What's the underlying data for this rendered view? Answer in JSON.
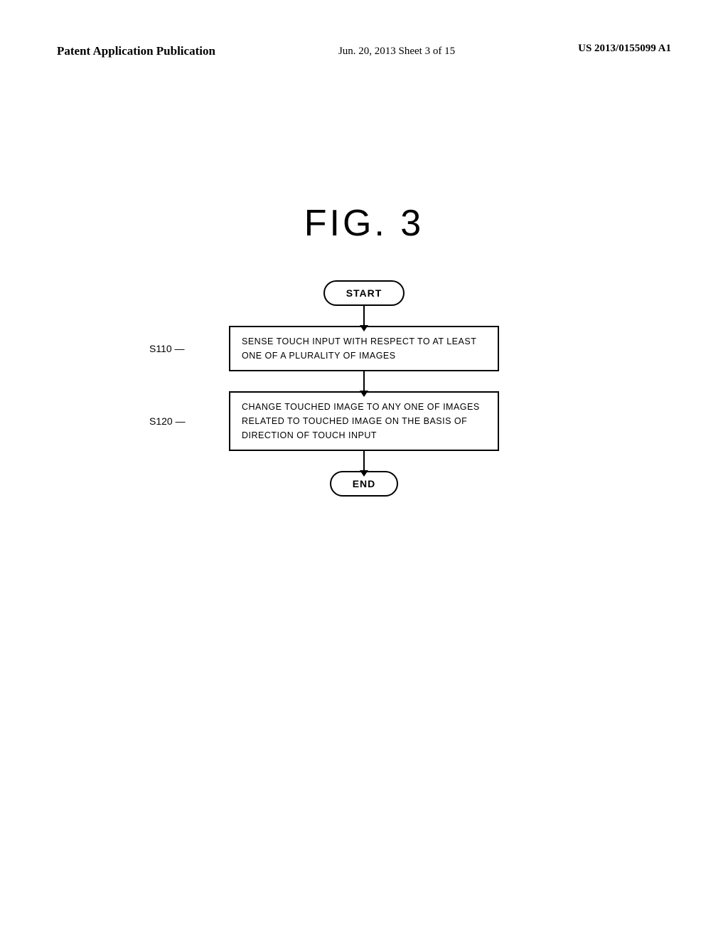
{
  "header": {
    "left_label": "Patent Application Publication",
    "center_label": "Jun. 20, 2013  Sheet 3 of 15",
    "right_label": "US 2013/0155099 A1"
  },
  "figure": {
    "title": "FIG.   3"
  },
  "flowchart": {
    "start_label": "START",
    "end_label": "END",
    "steps": [
      {
        "id": "S110",
        "label": "S110",
        "text": "SENSE TOUCH INPUT WITH RESPECT TO AT LEAST\nONE OF A PLURALITY OF IMAGES"
      },
      {
        "id": "S120",
        "label": "S120",
        "text": "CHANGE TOUCHED IMAGE TO ANY ONE OF IMAGES\nRELATED TO TOUCHED IMAGE ON THE BASIS OF\nDIRECTION OF TOUCH INPUT"
      }
    ]
  }
}
